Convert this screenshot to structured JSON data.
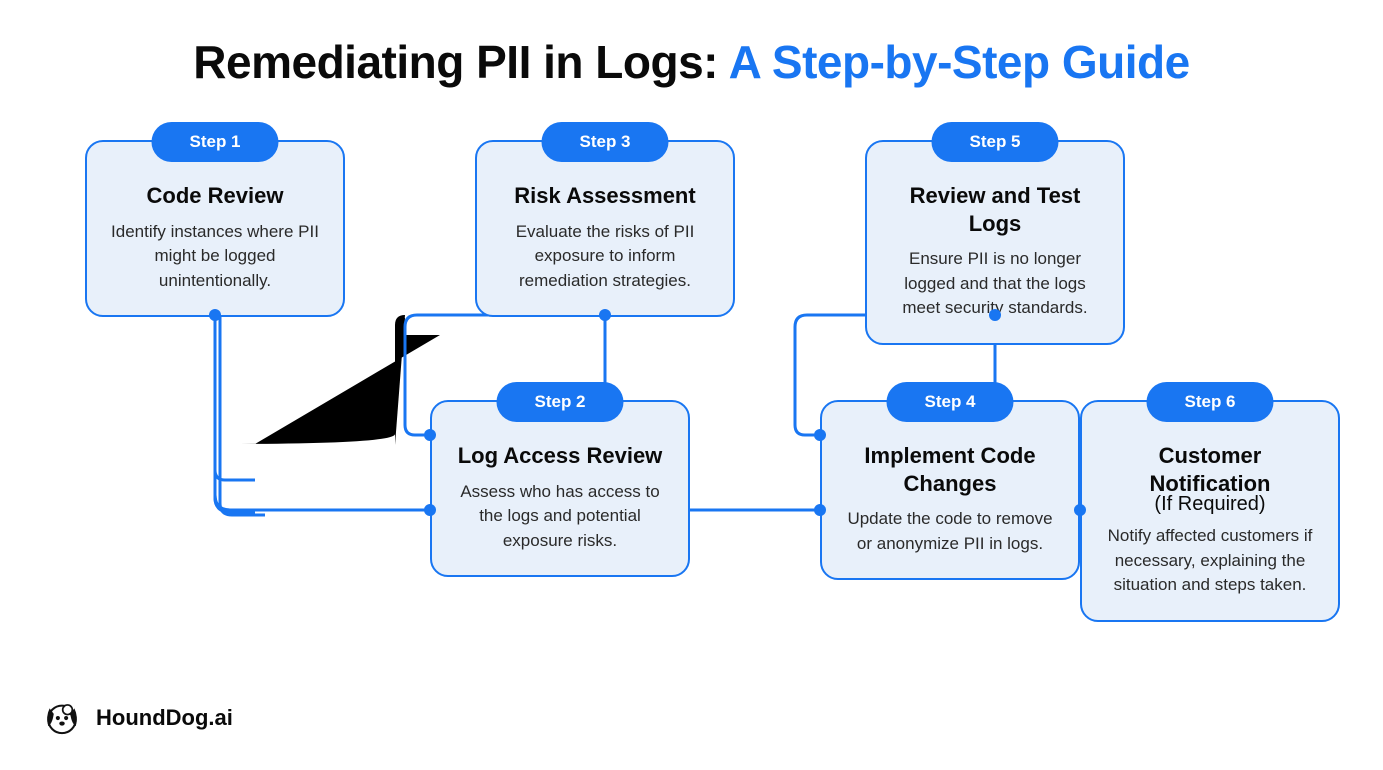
{
  "title_main": "Remediating PII in Logs:",
  "title_accent": "A Step-by-Step Guide",
  "brand": "HoundDog.ai",
  "steps": [
    {
      "pill": "Step 1",
      "title": "Code Review",
      "subtitle": "",
      "desc": "Identify instances where PII might be logged unintentionally."
    },
    {
      "pill": "Step 2",
      "title": "Log Access Review",
      "subtitle": "",
      "desc": "Assess who has access to the logs and potential exposure risks."
    },
    {
      "pill": "Step 3",
      "title": "Risk Assessment",
      "subtitle": "",
      "desc": "Evaluate the risks of PII exposure to inform remediation strategies."
    },
    {
      "pill": "Step 4",
      "title": "Implement Code Changes",
      "subtitle": "",
      "desc": "Update the code to remove or anonymize PII in logs."
    },
    {
      "pill": "Step 5",
      "title": "Review and Test Logs",
      "subtitle": "",
      "desc": "Ensure PII is no longer logged and that the logs meet security standards."
    },
    {
      "pill": "Step 6",
      "title": "Customer Notification",
      "subtitle": "(If Required)",
      "desc": "Notify affected customers if necessary, explaining the situation and steps taken."
    }
  ],
  "colors": {
    "accent": "#1976f2",
    "card_bg": "#e8f0fa"
  }
}
